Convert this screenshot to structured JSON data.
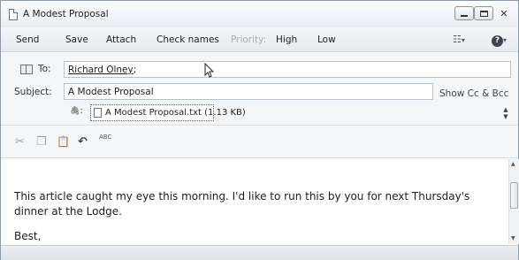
{
  "window": {
    "title": "A Modest Proposal",
    "close_glyph": "✕"
  },
  "menu": {
    "send": "Send",
    "save": "Save",
    "attach": "Attach",
    "check_names": "Check names",
    "priority_label": "Priority:",
    "high": "High",
    "low": "Low",
    "dropdown_glyph": "▾",
    "help_glyph": "?"
  },
  "header": {
    "to_label": "To:",
    "to_value": "Richard Olney",
    "to_suffix": ";",
    "subject_label": "Subject:",
    "subject_value": "A Modest Proposal",
    "show_cc": "Show Cc & Bcc",
    "attachment_glyph": "🖇",
    "attachment_label_suffix": ":",
    "attachment_name": "A Modest Proposal.txt (1.13 KB)"
  },
  "format_toolbar": {
    "cut": "✂",
    "copy": "❐",
    "paste": "📋",
    "undo": "↶",
    "spell": "ABC"
  },
  "body": {
    "line1": "This article caught my eye this morning. I'd like to run this by you for next Thursday's",
    "line2": "dinner at the Lodge.",
    "signoff": "Best,"
  },
  "scroll": {
    "up": "▲",
    "down": "▼"
  }
}
